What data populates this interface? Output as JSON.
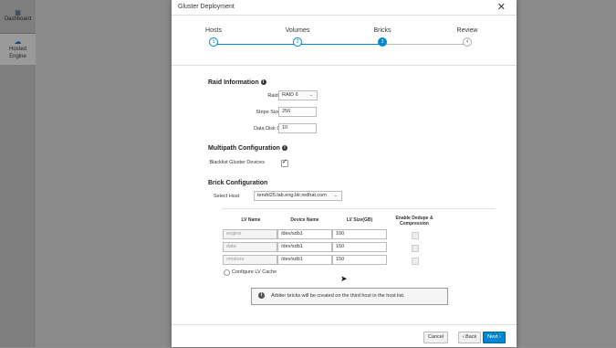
{
  "app": {
    "sidebar": [
      {
        "label": "Dashboard",
        "icon": "dashboard-icon"
      },
      {
        "label": "Hosted Engine",
        "icon": "hosted-engine-icon"
      }
    ]
  },
  "modal": {
    "title": "Gluster Deployment",
    "close_icon": "close-icon",
    "steps": [
      {
        "label": "Hosts",
        "number": "1",
        "state": "done"
      },
      {
        "label": "Volumes",
        "number": "2",
        "state": "done"
      },
      {
        "label": "Bricks",
        "number": "3",
        "state": "active"
      },
      {
        "label": "Review",
        "number": "4",
        "state": "future"
      }
    ],
    "raid": {
      "title": "Raid Information",
      "raid_type_label": "Raid Type",
      "raid_type_value": "RAID 6",
      "stripe_label": "Stripe Size(KB)",
      "stripe_value": "256",
      "disk_count_label": "Data Disk Count",
      "disk_count_value": "10"
    },
    "multipath": {
      "title": "Multipath Configuration",
      "blacklist_label": "Blacklist Gluster Devices",
      "blacklist_checked": true
    },
    "brick": {
      "title": "Brick Configuration",
      "select_host_label": "Select Host",
      "select_host_value": "tendrl25.lab.eng.blr.redhat.com",
      "columns": [
        "LV Name",
        "Device Name",
        "LV Size(GB)",
        "Enable Dedupe & Compression"
      ],
      "rows": [
        {
          "lv_name": "engine",
          "device": "/dev/sdb1",
          "size": "100",
          "dedupe": false
        },
        {
          "lv_name": "data",
          "device": "/dev/sdb1",
          "size": "150",
          "dedupe": false
        },
        {
          "lv_name": "vmstore",
          "device": "/dev/sdb1",
          "size": "150",
          "dedupe": false
        }
      ],
      "lv_cache_label": "Configure LV Cache"
    },
    "alert": "Arbiter bricks will be created on the third host in the host list.",
    "footer": {
      "cancel": "Cancel",
      "back": "‹ Back",
      "next": "Next ›"
    }
  }
}
